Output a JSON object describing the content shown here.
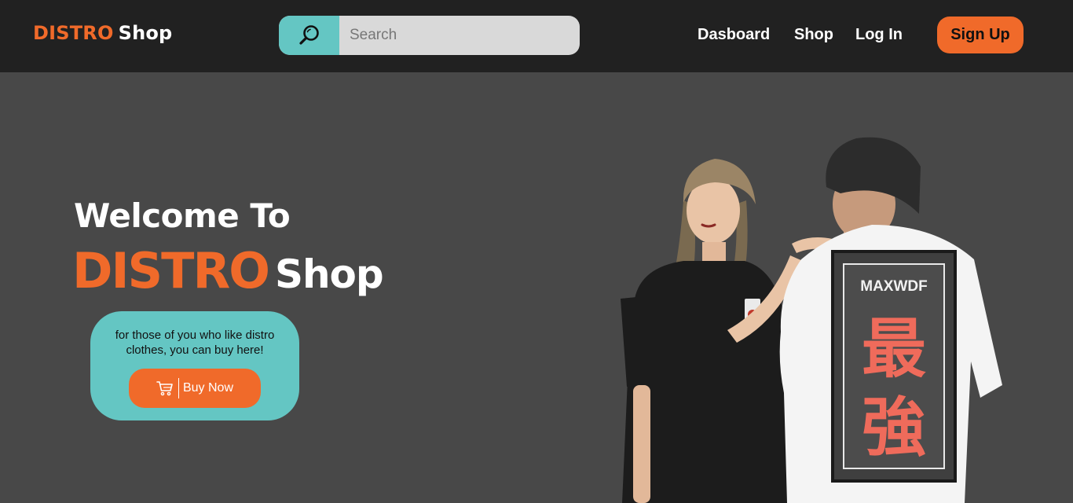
{
  "header": {
    "logo_primary": "DISTRO",
    "logo_secondary": "Shop",
    "search": {
      "placeholder": "Search",
      "icon": "search-icon"
    },
    "nav": {
      "dashboard": "Dasboard",
      "shop": "Shop",
      "login": "Log In",
      "signup": "Sign Up"
    }
  },
  "hero": {
    "welcome": "Welcome To",
    "brand_primary": "DISTRO",
    "brand_secondary": "Shop",
    "tagline": "for those of you who like distro clothes, you can buy here!",
    "buy_button": "Buy Now",
    "buy_icon": "cart-icon",
    "shirt_brand": "MAXWDF",
    "shirt_chars": [
      "最",
      "強"
    ]
  },
  "colors": {
    "accent": "#f06a2a",
    "teal": "#64c6c3",
    "header_bg": "#212121",
    "page_bg": "#484848"
  }
}
